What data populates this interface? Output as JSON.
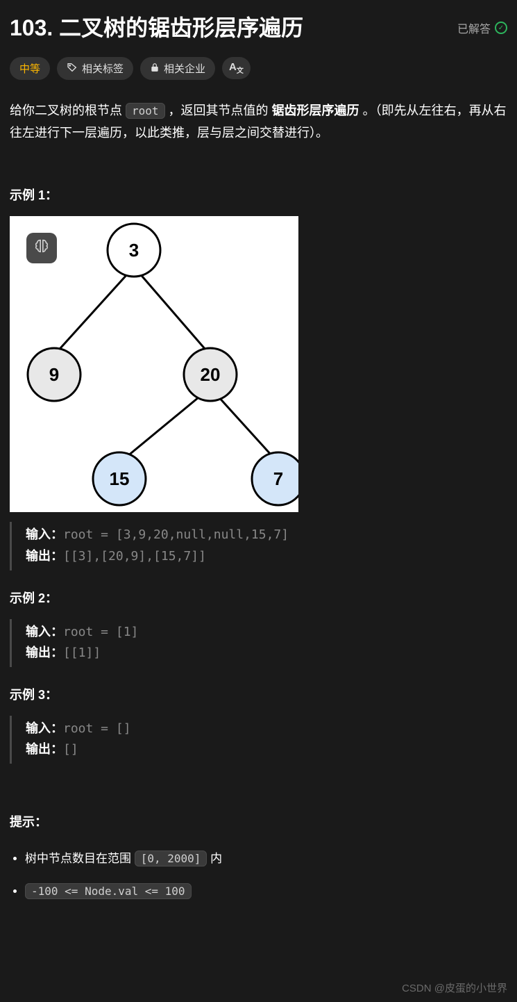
{
  "header": {
    "title": "103. 二叉树的锯齿形层序遍历",
    "solved_label": "已解答"
  },
  "tags": {
    "difficulty": "中等",
    "related_tags": "相关标签",
    "related_companies": "相关企业",
    "font_size": "A"
  },
  "description": {
    "pre": "给你二叉树的根节点 ",
    "code": "root",
    "mid": " ，返回其节点值的 ",
    "bold": "锯齿形层序遍历",
    "post": " 。（即先从左往右，再从右往左进行下一层遍历，以此类推，层与层之间交替进行）。"
  },
  "tree_nodes": {
    "n1": "3",
    "n2": "9",
    "n3": "20",
    "n4": "15",
    "n5": "7"
  },
  "examples": [
    {
      "title": "示例 1：",
      "input_label": "输入：",
      "input_val": "root = [3,9,20,null,null,15,7]",
      "output_label": "输出：",
      "output_val": "[[3],[20,9],[15,7]]",
      "has_image": true
    },
    {
      "title": "示例 2：",
      "input_label": "输入：",
      "input_val": "root = [1]",
      "output_label": "输出：",
      "output_val": "[[1]]",
      "has_image": false
    },
    {
      "title": "示例 3：",
      "input_label": "输入：",
      "input_val": "root = []",
      "output_label": "输出：",
      "output_val": "[]",
      "has_image": false
    }
  ],
  "hints": {
    "title": "提示：",
    "item1_pre": "树中节点数目在范围 ",
    "item1_code": "[0, 2000]",
    "item1_post": " 内",
    "item2_code": "-100 <= Node.val <= 100"
  },
  "watermark": "CSDN @皮蛋的小世界"
}
